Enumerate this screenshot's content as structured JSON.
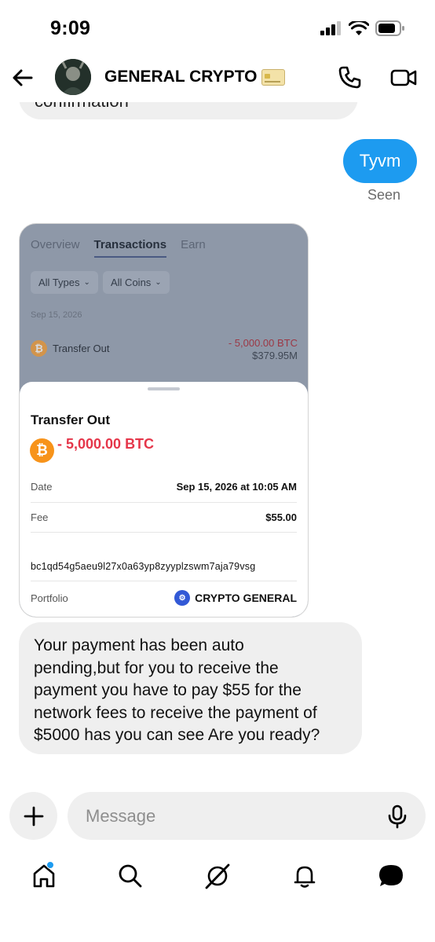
{
  "status_bar": {
    "time": "9:09"
  },
  "header": {
    "title": "GENERAL CRYPTO"
  },
  "messages": {
    "top_partial": "confirmation",
    "sent_text": "Tyvm",
    "seen": "Seen",
    "reply": "Your payment has been auto\npending,but for you to receive the\npayment you have to pay $55 for the\nnetwork fees to receive the payment of\n$5000 has you can see Are you ready?"
  },
  "screenshot": {
    "tabs": [
      "Overview",
      "Transactions",
      "Earn"
    ],
    "filters": [
      "All Types",
      "All Coins"
    ],
    "list_date": "Sep 15, 2026",
    "row_label": "Transfer Out",
    "row_amount": "- 5,000.00 BTC",
    "row_usd": "$379.95M",
    "sheet": {
      "title": "Transfer Out",
      "amount": "- 5,000.00 BTC",
      "date_label": "Date",
      "date_value": "Sep 15, 2026 at 10:05 AM",
      "fee_label": "Fee",
      "fee_value": "$55.00",
      "address": "bc1qd54g5aeu9l27x0a63yp8zyyplzswm7aja79vsg",
      "portfolio_label": "Portfolio",
      "portfolio_value": "CRYPTO GENERAL"
    }
  },
  "composer": {
    "placeholder": "Message"
  },
  "colors": {
    "accent": "#1d9bf0",
    "negative": "#e5364a",
    "bitcoin": "#f7931a"
  }
}
